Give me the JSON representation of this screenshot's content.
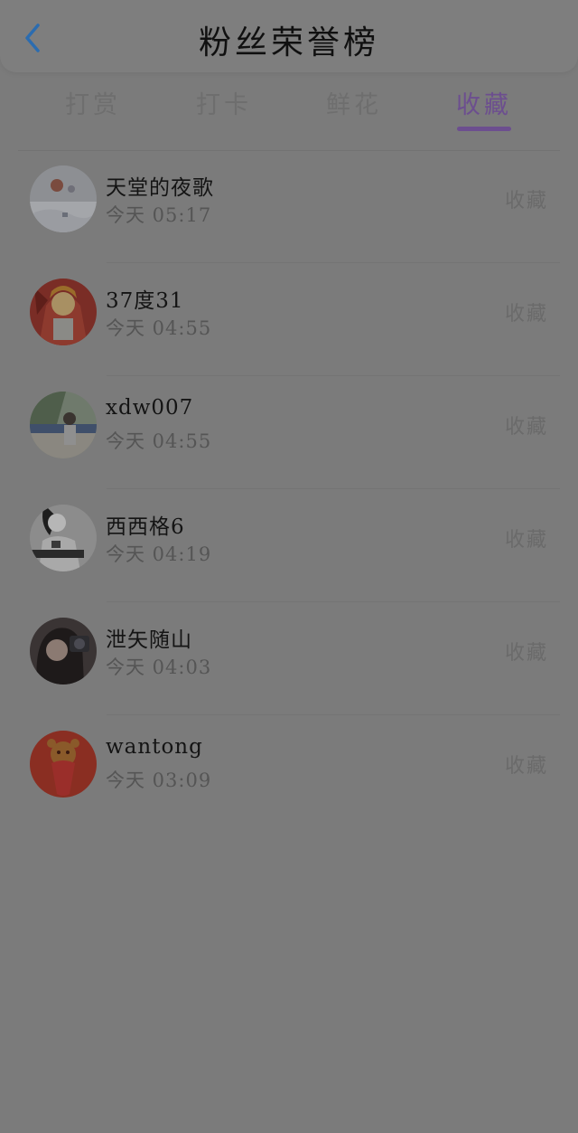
{
  "header": {
    "title": "粉丝荣誉榜",
    "back_icon": "chevron-left-icon",
    "back_color": "#2b6cb0"
  },
  "tabs": [
    {
      "label": "打赏",
      "active": false
    },
    {
      "label": "打卡",
      "active": false
    },
    {
      "label": "鲜花",
      "active": false
    },
    {
      "label": "收藏",
      "active": true
    }
  ],
  "accent_color": "#6c4e8f",
  "items": [
    {
      "name": "天堂的夜歌",
      "time": "今天 05:17",
      "action": "收藏"
    },
    {
      "name": "37度31",
      "time": "今天 04:55",
      "action": "收藏"
    },
    {
      "name": "xdw007",
      "time": "今天 04:55",
      "action": "收藏"
    },
    {
      "name": "西西格6",
      "time": "今天 04:19",
      "action": "收藏"
    },
    {
      "name": "泄矢随山",
      "time": "今天 04:03",
      "action": "收藏"
    },
    {
      "name": "wantong",
      "time": "今天 03:09",
      "action": "收藏"
    }
  ]
}
